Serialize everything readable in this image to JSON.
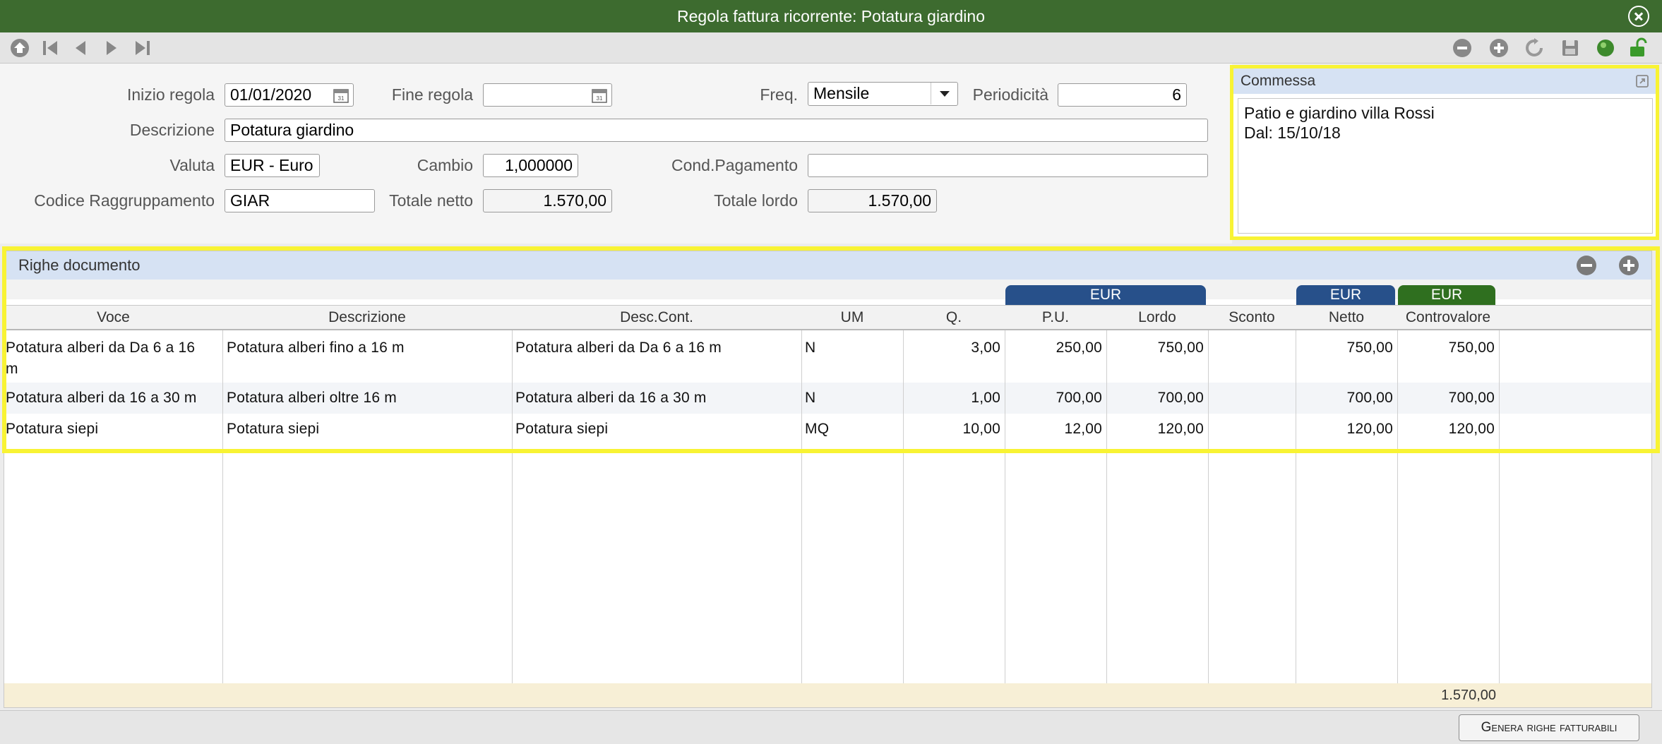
{
  "window": {
    "title": "Regola fattura ricorrente: Potatura giardino"
  },
  "toolbar": {
    "left_icons": [
      "home-icon",
      "first-record-icon",
      "previous-record-icon",
      "next-record-icon",
      "last-record-icon"
    ],
    "right_icons": [
      "remove-icon",
      "add-icon",
      "refresh-icon",
      "save-icon",
      "status-icon",
      "unlock-icon"
    ],
    "status_color": "#3d8a2c"
  },
  "form": {
    "inizio_regola": {
      "label": "Inizio regola",
      "value": "01/01/2020"
    },
    "fine_regola": {
      "label": "Fine regola",
      "value": ""
    },
    "freq": {
      "label": "Freq.",
      "value": "Mensile"
    },
    "periodicita": {
      "label": "Periodicità",
      "value": "6"
    },
    "descrizione": {
      "label": "Descrizione",
      "value": "Potatura giardino"
    },
    "valuta": {
      "label": "Valuta",
      "value": "EUR - Euro"
    },
    "cambio": {
      "label": "Cambio",
      "value": "1,000000"
    },
    "cond_pagamento": {
      "label": "Cond.Pagamento",
      "value": ""
    },
    "codice_raggruppamento": {
      "label": "Codice Raggruppamento",
      "value": "GIAR"
    },
    "totale_netto": {
      "label": "Totale netto",
      "value": "1.570,00"
    },
    "totale_lordo": {
      "label": "Totale lordo",
      "value": "1.570,00"
    }
  },
  "commessa": {
    "title": "Commessa",
    "line1": "Patio e giardino villa Rossi",
    "line2": "Dal: 15/10/18"
  },
  "righe": {
    "title": "Righe documento",
    "currency_tags": [
      {
        "label": "EUR",
        "color": "#27508a"
      },
      {
        "label": "EUR",
        "color": "#27508a"
      },
      {
        "label": "EUR",
        "color": "#2f6f1f"
      }
    ],
    "columns": [
      "Voce",
      "Descrizione",
      "Desc.Cont.",
      "UM",
      "Q.",
      "P.U.",
      "Lordo",
      "Sconto",
      "Netto",
      "Controvalore"
    ],
    "rows": [
      {
        "voce_a": "Potatura alberi da Da 6 a 16",
        "voce_b": "m",
        "descrizione": "Potatura alberi fino a 16 m",
        "desc_cont": "Potatura alberi da Da 6 a 16 m",
        "um": "N",
        "q": "3,00",
        "pu": "250,00",
        "lordo": "750,00",
        "sconto": "",
        "netto": "750,00",
        "controvalore": "750,00"
      },
      {
        "voce": "Potatura alberi da 16 a 30 m",
        "descrizione": "Potatura alberi oltre 16 m",
        "desc_cont": "Potatura alberi da 16 a 30 m",
        "um": "N",
        "q": "1,00",
        "pu": "700,00",
        "lordo": "700,00",
        "sconto": "",
        "netto": "700,00",
        "controvalore": "700,00"
      },
      {
        "voce": "Potatura siepi",
        "descrizione": "Potatura siepi",
        "desc_cont": "Potatura siepi",
        "um": "MQ",
        "q": "10,00",
        "pu": "12,00",
        "lordo": "120,00",
        "sconto": "",
        "netto": "120,00",
        "controvalore": "120,00"
      }
    ],
    "total_controvalore": "1.570,00"
  },
  "footer": {
    "generate_button": "Genera righe fatturabili"
  }
}
